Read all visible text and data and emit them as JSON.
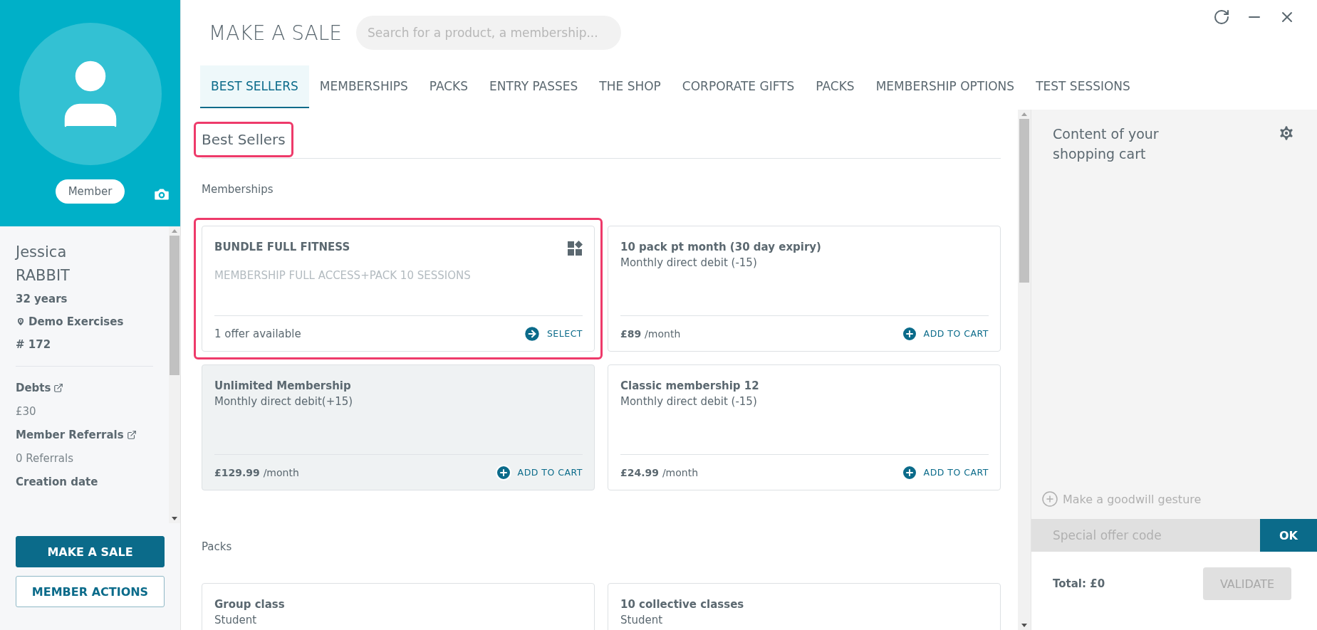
{
  "header": {
    "title": "MAKE A SALE",
    "search": {
      "placeholder": "Search for a product, a membership..."
    }
  },
  "tabs": [
    {
      "label": "BEST SELLERS",
      "selected": true
    },
    {
      "label": "MEMBERSHIPS",
      "selected": false
    },
    {
      "label": "PACKS",
      "selected": false
    },
    {
      "label": "ENTRY PASSES",
      "selected": false
    },
    {
      "label": "THE SHOP",
      "selected": false
    },
    {
      "label": "CORPORATE GIFTS",
      "selected": false
    },
    {
      "label": "PACKS",
      "selected": false
    },
    {
      "label": "MEMBERSHIP OPTIONS",
      "selected": false
    },
    {
      "label": "TEST SESSIONS",
      "selected": false
    }
  ],
  "member": {
    "badge": "Member",
    "first_name": "Jessica",
    "last_name": "RABBIT",
    "age": "32 years",
    "location": "Demo Exercises",
    "number": "# 172",
    "fields": [
      {
        "label": "Debts",
        "value": "£30",
        "link": true
      },
      {
        "label": "Member Referrals",
        "value": "0 Referrals",
        "link": true
      },
      {
        "label": "Creation date",
        "link": false
      }
    ]
  },
  "member_buttons": [
    {
      "label": "MAKE A SALE",
      "primary": true
    },
    {
      "label": "MEMBER ACTIONS",
      "primary": false
    }
  ],
  "catalog": {
    "heading": "Best Sellers",
    "heading_highlighted": true,
    "sections": [
      {
        "title": "Memberships",
        "cards": [
          {
            "kind": "bundle",
            "title": "BUNDLE FULL FITNESS",
            "description": "MEMBERSHIP FULL ACCESS+PACK 10 SESSIONS",
            "offer": "1 offer available",
            "action": "SELECT",
            "highlighted": true,
            "hovered": false
          },
          {
            "kind": "product",
            "title": "10 pack pt month (30 day expiry)",
            "subtitle": "Monthly direct debit (-15)",
            "price": "£89",
            "per": "/month",
            "action": "ADD TO CART",
            "highlighted": false,
            "hovered": false
          },
          {
            "kind": "product",
            "title": "Unlimited Membership",
            "subtitle": "Monthly direct debit(+15)",
            "price": "£129.99",
            "per": "/month",
            "action": "ADD TO CART",
            "highlighted": false,
            "hovered": true
          },
          {
            "kind": "product",
            "title": "Classic membership 12",
            "subtitle": "Monthly direct debit (-15)",
            "price": "£24.99",
            "per": "/month",
            "action": "ADD TO CART",
            "highlighted": false,
            "hovered": false
          }
        ]
      },
      {
        "title": "Packs",
        "cards": [
          {
            "kind": "product",
            "title": "Group class",
            "subtitle": "Student",
            "highlighted": false,
            "hovered": false
          },
          {
            "kind": "product",
            "title": "10 collective classes",
            "subtitle": "Student",
            "highlighted": false,
            "hovered": false
          }
        ]
      }
    ]
  },
  "cart": {
    "title": "Content of your shopping cart",
    "goodwill": "Make a goodwill gesture",
    "code": {
      "placeholder": "Special offer code",
      "button": "OK"
    },
    "total": "Total: £0",
    "validate": {
      "label": "VALIDATE",
      "disabled": true
    }
  }
}
